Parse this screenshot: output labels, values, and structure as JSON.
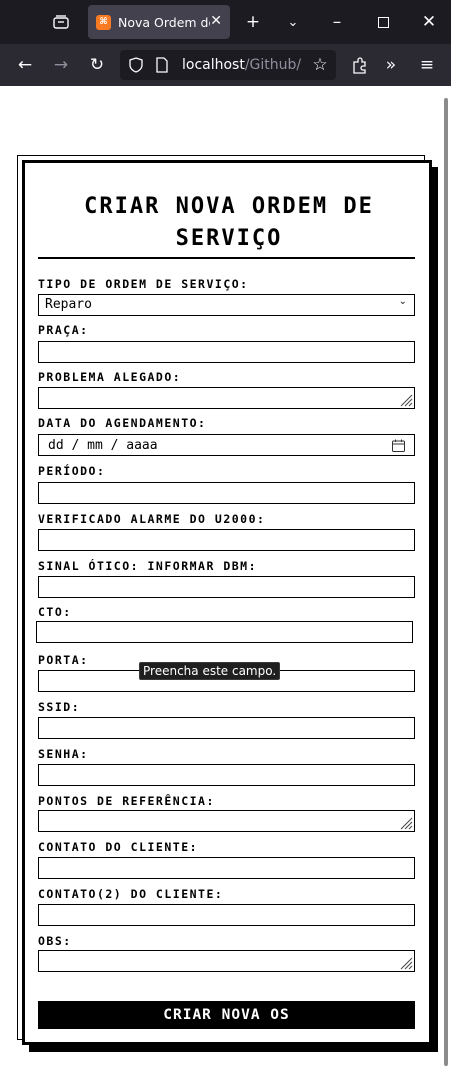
{
  "browser": {
    "tab_title": "Nova Ordem de",
    "favicon_text": "⌘",
    "url_host": "localhost",
    "url_path": "/Github/O..",
    "icons": [
      "tab-list-icon",
      "close-icon",
      "new-tab-icon",
      "chevron-down-icon",
      "minimize-icon",
      "maximize-icon",
      "window-close-icon",
      "back-icon",
      "forward-icon",
      "reload-icon",
      "shield-icon",
      "page-icon",
      "bookmark-star-icon",
      "extensions-icon",
      "overflow-icon",
      "menu-icon"
    ]
  },
  "form": {
    "title": "CRIAR NOVA ORDEM DE SERVIÇO",
    "fields": {
      "tipo": {
        "label": "TIPO DE ORDEM DE SERVIÇO:",
        "value": "Reparo"
      },
      "praca": {
        "label": "PRAÇA:"
      },
      "problema": {
        "label": "PROBLEMA ALEGADO:"
      },
      "data": {
        "label": "DATA DO AGENDAMENTO:",
        "placeholder": "dd / mm / aaaa"
      },
      "periodo": {
        "label": "PERÍODO:"
      },
      "alarme": {
        "label": "VERIFICADO ALARME DO U2000:"
      },
      "sinal": {
        "label": "SINAL ÓTICO: INFORMAR DBM:"
      },
      "cto": {
        "label": "CTO:"
      },
      "porta": {
        "label": "PORTA:"
      },
      "ssid": {
        "label": "SSID:"
      },
      "senha": {
        "label": "SENHA:"
      },
      "pontos": {
        "label": "PONTOS DE REFERÊNCIA:"
      },
      "contato1": {
        "label": "CONTATO DO CLIENTE:"
      },
      "contato2": {
        "label": "CONTATO(2) DO CLIENTE:"
      },
      "obs": {
        "label": "OBS:"
      }
    },
    "tooltip": "Preencha este campo.",
    "submit_label": "CRIAR NOVA OS"
  }
}
